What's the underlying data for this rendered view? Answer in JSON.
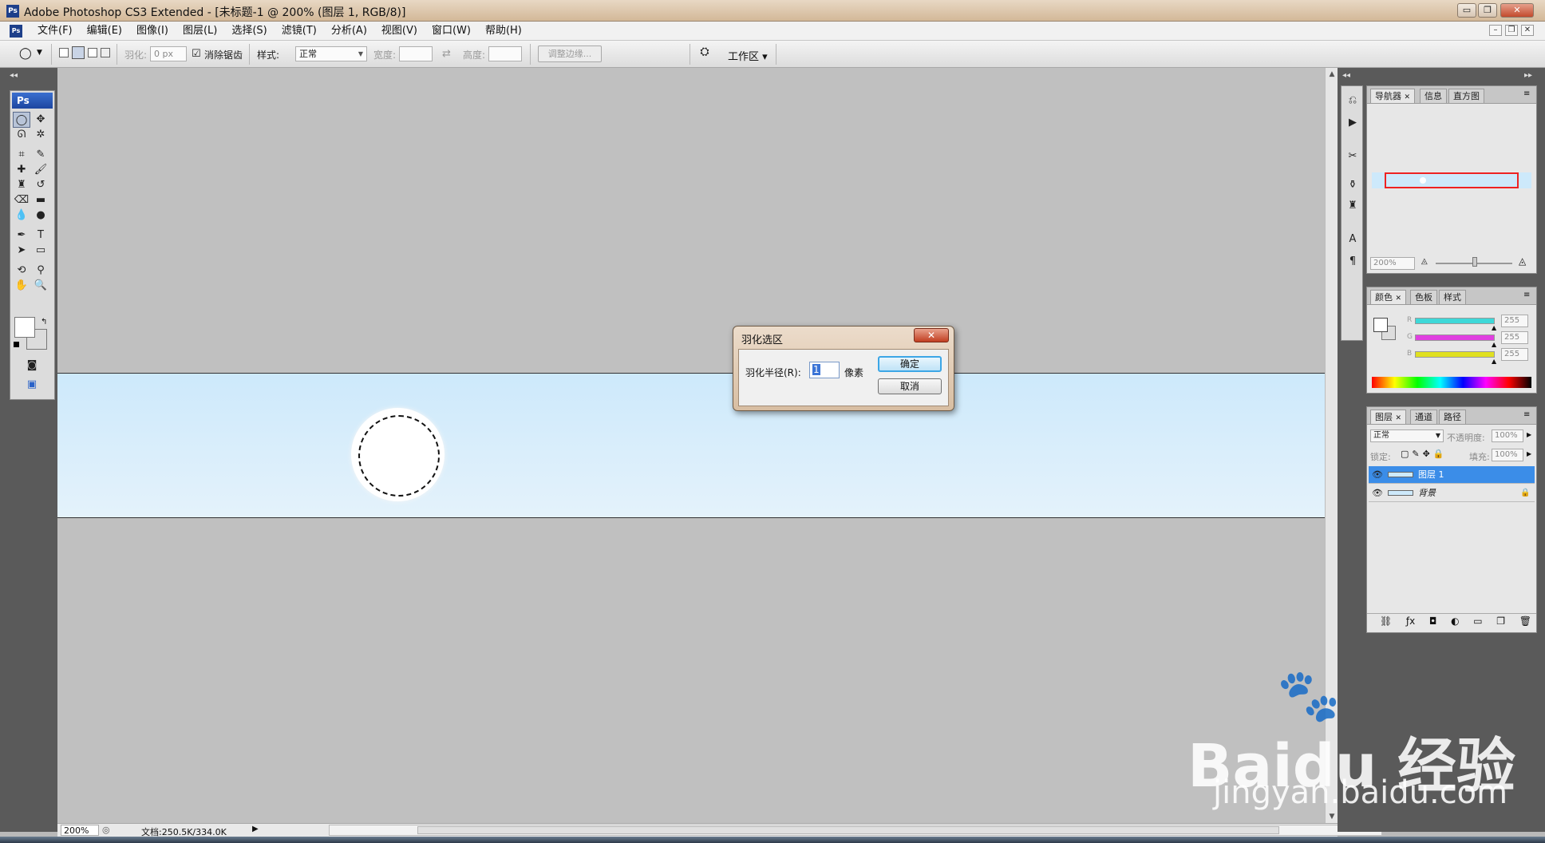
{
  "window": {
    "title": "Adobe Photoshop CS3 Extended - [未标题-1 @ 200% (图层 1, RGB/8)]",
    "app_icon": "Ps",
    "minimize": "▭",
    "restore": "❐",
    "close": "✕"
  },
  "menu": {
    "items": [
      "文件(F)",
      "编辑(E)",
      "图像(I)",
      "图层(L)",
      "选择(S)",
      "滤镜(T)",
      "分析(A)",
      "视图(V)",
      "窗口(W)",
      "帮助(H)"
    ],
    "doc_minimize": "–",
    "doc_restore": "❐",
    "doc_close": "✕"
  },
  "options": {
    "feather_label": "羽化:",
    "feather_value": "0 px",
    "antialias_label": "消除锯齿",
    "antialias_checked": "☑",
    "style_label": "样式:",
    "style_value": "正常",
    "width_label": "宽度:",
    "height_label": "高度:",
    "refine_edge": "调整边缘...",
    "workspace_label": "工作区 ▾"
  },
  "toolbox": {
    "header": "Ps",
    "tools": [
      {
        "name": "elliptical-marquee-icon",
        "glyph": "◯",
        "active": true
      },
      {
        "name": "move-tool-icon",
        "glyph": "✥"
      },
      {
        "name": "lasso-tool-icon",
        "glyph": "ᘏ"
      },
      {
        "name": "magic-wand-icon",
        "glyph": "✲"
      },
      {
        "name": "crop-tool-icon",
        "glyph": "⌗"
      },
      {
        "name": "slice-tool-icon",
        "glyph": "✎"
      },
      {
        "name": "healing-brush-icon",
        "glyph": "✚"
      },
      {
        "name": "brush-tool-icon",
        "glyph": "🖌"
      },
      {
        "name": "clone-stamp-icon",
        "glyph": "♜"
      },
      {
        "name": "history-brush-icon",
        "glyph": "↺"
      },
      {
        "name": "eraser-tool-icon",
        "glyph": "⌫"
      },
      {
        "name": "gradient-tool-icon",
        "glyph": "▬"
      },
      {
        "name": "blur-tool-icon",
        "glyph": "💧"
      },
      {
        "name": "dodge-tool-icon",
        "glyph": "●"
      },
      {
        "name": "pen-tool-icon",
        "glyph": "✒"
      },
      {
        "name": "type-tool-icon",
        "glyph": "T"
      },
      {
        "name": "path-selection-icon",
        "glyph": "➤"
      },
      {
        "name": "shape-tool-icon",
        "glyph": "▭"
      },
      {
        "name": "3d-rotate-icon",
        "glyph": "⟲"
      },
      {
        "name": "eyedropper-icon",
        "glyph": "⚲"
      },
      {
        "name": "hand-tool-icon",
        "glyph": "✋"
      },
      {
        "name": "zoom-tool-icon",
        "glyph": "🔍"
      }
    ],
    "quick_mask": "◙",
    "screen_mode": "▣"
  },
  "status": {
    "zoom": "200%",
    "doc_info": "文档:250.5K/334.0K"
  },
  "navigator_panel": {
    "tabs": [
      "导航器",
      "信息",
      "直方图"
    ],
    "zoom": "200%"
  },
  "color_panel": {
    "tabs": [
      "颜色",
      "色板",
      "样式"
    ],
    "channels": [
      {
        "label": "R",
        "value": "255",
        "color": "#3ed8d8"
      },
      {
        "label": "G",
        "value": "255",
        "color": "#e040e0"
      },
      {
        "label": "B",
        "value": "255",
        "color": "#e0e020"
      }
    ]
  },
  "layers_panel": {
    "tabs": [
      "图层",
      "通道",
      "路径"
    ],
    "blend_mode": "正常",
    "opacity_label": "不透明度:",
    "opacity_value": "100%",
    "lock_label": "锁定:",
    "fill_label": "填充:",
    "fill_value": "100%",
    "layers": [
      {
        "name": "图层 1",
        "selected": true
      },
      {
        "name": "背景",
        "locked": true
      }
    ],
    "footer_icons": [
      "link-icon",
      "fx-icon",
      "mask-icon",
      "adjustment-icon",
      "group-icon",
      "new-layer-icon",
      "trash-icon"
    ]
  },
  "dialog": {
    "title": "羽化选区",
    "radius_label": "羽化半径(R):",
    "radius_value": "1",
    "unit": "像素",
    "ok": "确定",
    "cancel": "取消",
    "close": "✕"
  },
  "watermark": {
    "brand": "Bai",
    "brand_suffix": "du",
    "product": "经验",
    "url": "jingyan.baidu.com"
  }
}
